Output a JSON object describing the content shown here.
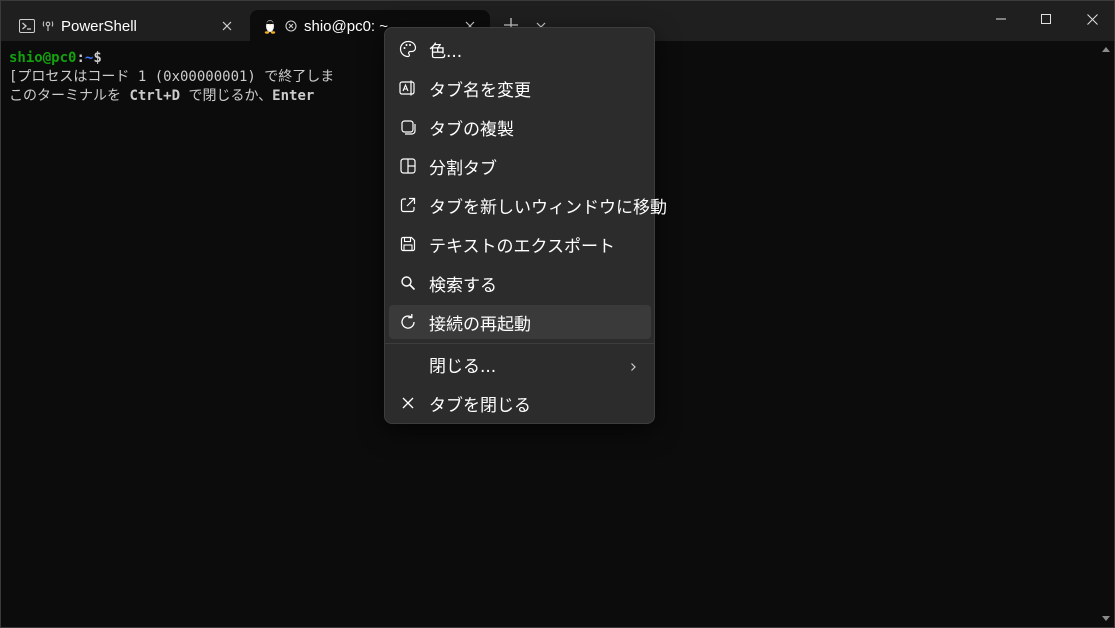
{
  "tabs": [
    {
      "title": "PowerShell",
      "icon": "powershell-icon",
      "status_icon": "network-icon"
    },
    {
      "title": "shio@pc0: ~",
      "icon": "linux-tux-icon",
      "status_icon": "disconnected-icon"
    }
  ],
  "titlebar": {
    "new_tab_icon": "plus-icon",
    "dropdown_icon": "chevron-down-icon",
    "window_controls": [
      "minimize-icon",
      "maximize-icon",
      "close-icon"
    ]
  },
  "terminal": {
    "prompt": {
      "user": "shio@pc0",
      "sep": ":",
      "path": "~",
      "symbol": "$"
    },
    "line2": "[プロセスはコード 1 (0x00000001) で終了しま",
    "line3_prefix": "このターミナルを ",
    "line3_key1": "Ctrl+D",
    "line3_mid": " で閉じるか、",
    "line3_key2": "Enter"
  },
  "context_menu": {
    "items": [
      {
        "label": "色...",
        "icon": "palette-icon"
      },
      {
        "label": "タブ名を変更",
        "icon": "rename-icon"
      },
      {
        "label": "タブの複製",
        "icon": "duplicate-icon"
      },
      {
        "label": "分割タブ",
        "icon": "split-icon"
      },
      {
        "label": "タブを新しいウィンドウに移動",
        "icon": "open-external-icon"
      },
      {
        "label": "テキストのエクスポート",
        "icon": "save-icon"
      },
      {
        "label": "検索する",
        "icon": "search-icon"
      },
      {
        "label": "接続の再起動",
        "icon": "restart-icon"
      },
      {
        "label": "閉じる...",
        "icon": "",
        "submenu_icon": "chevron-right-icon"
      },
      {
        "label": "タブを閉じる",
        "icon": "close-icon"
      }
    ]
  },
  "colors": {
    "titlebar": "#1f1f1f",
    "terminal_bg": "#0c0c0c",
    "menu_bg": "#2c2c2c",
    "prompt_user": "#13a10e",
    "prompt_path": "#3b78ff"
  }
}
